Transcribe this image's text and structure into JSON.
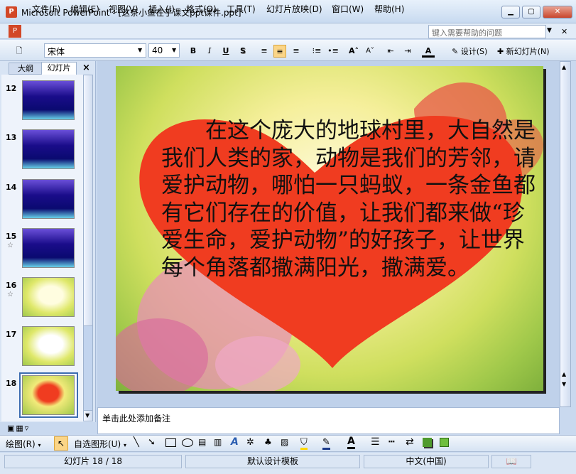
{
  "window": {
    "title": "Microsoft PowerPoint - [这条小鱼在乎课文ppt课件.ppt]",
    "app_icon": "powerpoint-icon"
  },
  "menu": {
    "items": [
      "文件(F)",
      "编辑(E)",
      "视图(V)",
      "插入(I)",
      "格式(O)",
      "工具(T)",
      "幻灯片放映(D)",
      "窗口(W)",
      "帮助(H)"
    ]
  },
  "help": {
    "placeholder": "键入需要帮助的问题"
  },
  "toolbar": {
    "font": "宋体",
    "size": "40",
    "bold": "B",
    "italic": "I",
    "underline": "U",
    "shadow": "S",
    "design_label": "设计(S)",
    "new_slide_label": "新幻灯片(N)"
  },
  "pane": {
    "tab_outline": "大纲",
    "tab_slides": "幻灯片",
    "close": "×",
    "thumbs": [
      {
        "num": "12"
      },
      {
        "num": "13"
      },
      {
        "num": "14"
      },
      {
        "num": "15",
        "star": "☆"
      },
      {
        "num": "16",
        "star": "☆"
      },
      {
        "num": "17"
      },
      {
        "num": "18"
      }
    ]
  },
  "slide": {
    "text": "　　在这个庞大的地球村里，大自然是我们人类的家，动物是我们的芳邻，请爱护动物，哪怕一只蚂蚁，一条金鱼都有它们存在的价值，让我们都来做“珍爱生命，爱护动物”的好孩子，让世界每个角落都撒满阳光，撒满爱。"
  },
  "notes": {
    "placeholder": "单击此处添加备注"
  },
  "drawbar": {
    "draw": "绘图(R)",
    "autoshapes": "自选图形(U)"
  },
  "status": {
    "slide": "幻灯片 18 / 18",
    "template": "默认设计模板",
    "language": "中文(中国)"
  },
  "colors": {
    "heart": "#f03c20",
    "accent": "#fbd587"
  }
}
